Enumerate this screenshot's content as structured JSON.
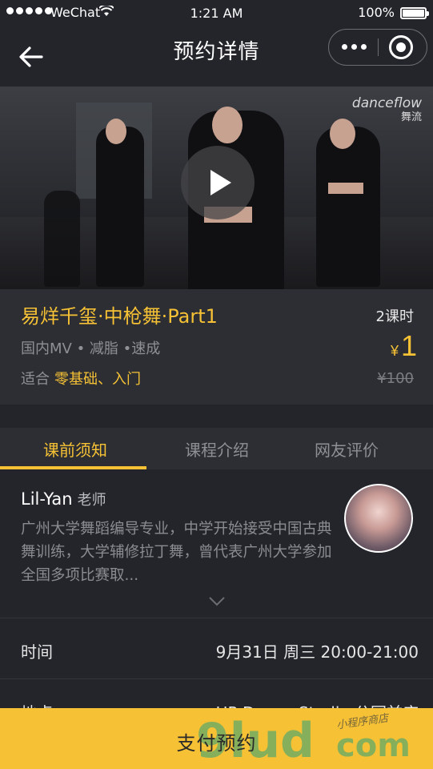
{
  "status_bar": {
    "carrier": "WeChat",
    "time": "1:21 AM",
    "battery": "100%"
  },
  "nav": {
    "title": "预约详情"
  },
  "video": {
    "watermark_brand": "danceflow",
    "watermark_sub": "舞流"
  },
  "course": {
    "title": "易烊千玺·中枪舞·Part1",
    "lessons": "2课时",
    "tags": "国内MV • 减脂 •速成",
    "price_symbol": "¥",
    "price": "1",
    "suitable_label": "适合",
    "suitable_level": "零基础、入门",
    "original_price": "¥100"
  },
  "tabs": [
    {
      "label": "课前须知",
      "active": true
    },
    {
      "label": "课程介绍",
      "active": false
    },
    {
      "label": "网友评价",
      "active": false
    }
  ],
  "teacher": {
    "name": "Lil-Yan",
    "role": "老师",
    "description": "广州大学舞蹈编导专业，中学开始接受中国古典舞训练，大学辅修拉丁舞，曾代表广州大学参加全国多项比赛取..."
  },
  "info": {
    "time_label": "时间",
    "time_value": "9月31日 周三 20:00-21:00",
    "location_label": "地点",
    "location_value": "HP Dance Studio 公园前店"
  },
  "pay": {
    "label": "支付预约"
  },
  "overlay_watermark": {
    "main": "9lud",
    "com": "com",
    "small": "小程序商店"
  },
  "colors": {
    "accent": "#f6c135",
    "background": "#23252b",
    "panel": "#2c2e33"
  }
}
